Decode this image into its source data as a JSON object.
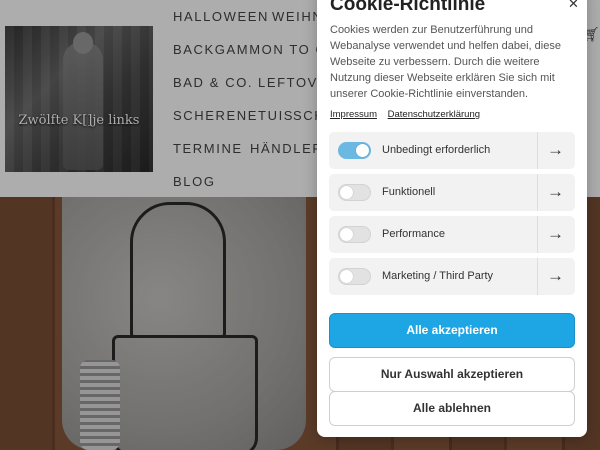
{
  "site": {
    "logo_text": "Zwölfte K[]je links",
    "nav": [
      "HALLOWEEN",
      "WEIHN",
      "BACKGAMMON TO GO",
      "BAD & CO.",
      "LEFTOVE",
      "SCHERENETUIS",
      "SCH",
      "TERMINE",
      "HÄNDLER",
      "BLOG"
    ]
  },
  "cookie": {
    "title": "Cookie-Richtlinie",
    "close_icon": "close-icon",
    "text": "Cookies werden zur Benutzerführung und Webanalyse verwendet und helfen dabei, diese Webseite zu verbessern. Durch die weitere Nutzung dieser Webseite erklären Sie sich mit unserer Cookie-Richtlinie einverstanden.",
    "links": {
      "impressum": "Impressum",
      "datenschutz": "Datenschutzerklärung"
    },
    "options": [
      {
        "label": "Unbedingt erforderlich",
        "enabled": true
      },
      {
        "label": "Funktionell",
        "enabled": false
      },
      {
        "label": "Performance",
        "enabled": false
      },
      {
        "label": "Marketing / Third Party",
        "enabled": false
      }
    ],
    "arrow_icon": "arrow-right-icon",
    "buttons": {
      "accept_all": "Alle akzeptieren",
      "accept_selection": "Nur Auswahl akzeptieren",
      "reject_all": "Alle ablehnen"
    }
  },
  "colors": {
    "accent": "#1ea5e3",
    "toggle_on": "#6bb8e3"
  }
}
